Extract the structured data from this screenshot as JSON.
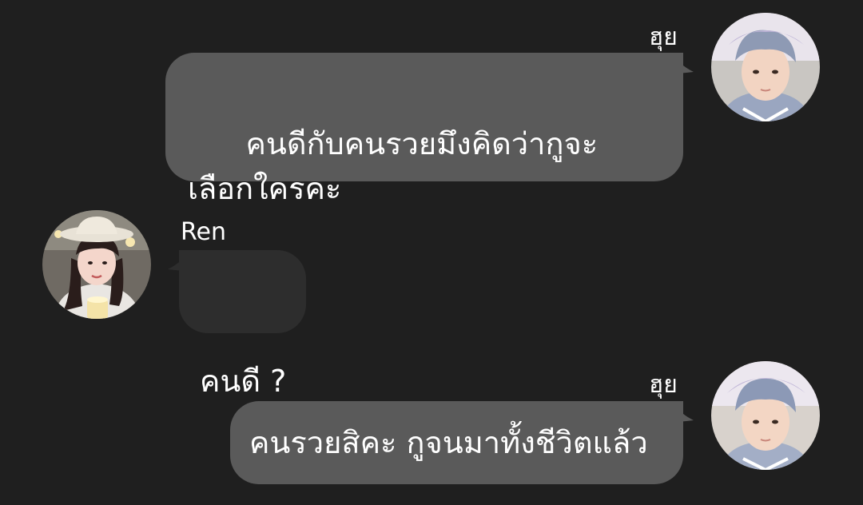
{
  "messages": [
    {
      "direction": "outgoing",
      "sender": "ฮุย",
      "text": "คนดีกับคนรวยมึงคิดว่ากูจะเลือกใครคะ",
      "avatar": "avatar-photo-boy"
    },
    {
      "direction": "incoming",
      "sender": "Ren",
      "text": "คนดี ?",
      "avatar": "avatar-photo-girl"
    },
    {
      "direction": "outgoing",
      "sender": "ฮุย",
      "text": "คนรวยสิคะ กูจนมาทั้งชีวิตแล้ว",
      "avatar": "avatar-photo-boy"
    }
  ],
  "colors": {
    "background": "#1f1f1f",
    "outgoing_bubble": "#5a5a5a",
    "incoming_bubble": "#2d2d2d",
    "text": "#ffffff"
  }
}
